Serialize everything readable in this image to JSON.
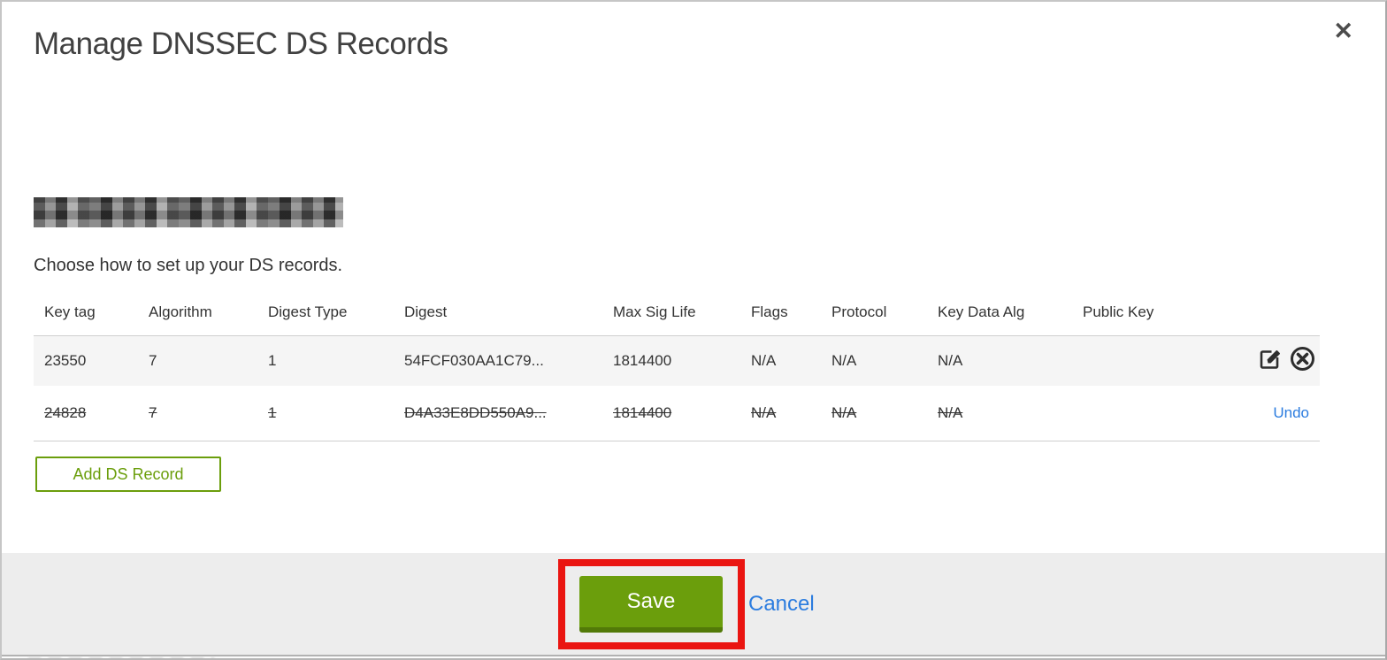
{
  "modal": {
    "title": "Manage DNSSEC DS Records",
    "close_icon": "✕",
    "instruction": "Choose how to set up your DS records."
  },
  "table": {
    "columns": [
      "Key tag",
      "Algorithm",
      "Digest Type",
      "Digest",
      "Max Sig Life",
      "Flags",
      "Protocol",
      "Key Data Alg",
      "Public Key"
    ],
    "rows": [
      {
        "key_tag": "23550",
        "algorithm": "7",
        "digest_type": "1",
        "digest": "54FCF030AA1C79...",
        "max_sig_life": "1814400",
        "flags": "N/A",
        "protocol": "N/A",
        "key_data_alg": "N/A",
        "public_key": "",
        "status": "active",
        "action_icons": [
          "edit-icon",
          "delete-icon"
        ]
      },
      {
        "key_tag": "24828",
        "algorithm": "7",
        "digest_type": "1",
        "digest": "D4A33E8DD550A9...",
        "max_sig_life": "1814400",
        "flags": "N/A",
        "protocol": "N/A",
        "key_data_alg": "N/A",
        "public_key": "",
        "status": "pending-delete",
        "undo_label": "Undo"
      }
    ]
  },
  "actions": {
    "add_ds_record_label": "Add DS Record",
    "save_label": "Save",
    "cancel_label": "Cancel"
  },
  "annotations": {
    "highlight_target": "save-button",
    "highlight_color": "#ea1511"
  },
  "colors": {
    "accent_green": "#6b9e0c",
    "save_border_green": "#527a08",
    "link_blue": "#2b7cdf",
    "footer_gray": "#ededed",
    "row_stripe_gray": "#f5f5f5",
    "text_dark": "#333333"
  }
}
